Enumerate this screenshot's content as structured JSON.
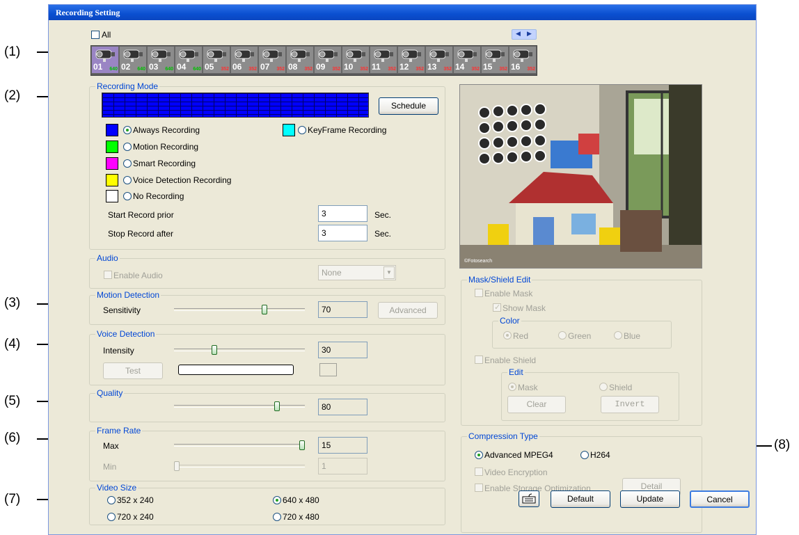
{
  "title": "Recording Setting",
  "callouts": [
    "(1)",
    "(2)",
    "(3)",
    "(4)",
    "(5)",
    "(6)",
    "(7)",
    "(8)"
  ],
  "camera_bar": {
    "all_label": "All",
    "cameras": [
      {
        "num": "01",
        "res": "640"
      },
      {
        "num": "02",
        "res": "640"
      },
      {
        "num": "03",
        "res": "640"
      },
      {
        "num": "04",
        "res": "640"
      },
      {
        "num": "05",
        "res": "352"
      },
      {
        "num": "06",
        "res": "352"
      },
      {
        "num": "07",
        "res": "352"
      },
      {
        "num": "08",
        "res": "352"
      },
      {
        "num": "09",
        "res": "352"
      },
      {
        "num": "10",
        "res": "352"
      },
      {
        "num": "11",
        "res": "352"
      },
      {
        "num": "12",
        "res": "352"
      },
      {
        "num": "13",
        "res": "352"
      },
      {
        "num": "14",
        "res": "352"
      },
      {
        "num": "15",
        "res": "352"
      },
      {
        "num": "16",
        "res": "352"
      }
    ],
    "selected": "01",
    "icons": [
      "camera-icon",
      "chevron-left-icon",
      "chevron-right-icon"
    ]
  },
  "recording_mode": {
    "label": "Recording Mode",
    "schedule_button": "Schedule",
    "options": [
      {
        "label": "Always Recording",
        "color": "#0000ff",
        "selected": true
      },
      {
        "label": "KeyFrame Recording",
        "color": "#00ffff",
        "selected": false
      },
      {
        "label": "Motion Recording",
        "color": "#00ff00",
        "selected": false
      },
      {
        "label": "Smart Recording",
        "color": "#ff00ff",
        "selected": false
      },
      {
        "label": "Voice Detection Recording",
        "color": "#ffff00",
        "selected": false
      },
      {
        "label": "No Recording",
        "color": "#ffffff",
        "selected": false
      }
    ],
    "start_prior_label": "Start Record prior",
    "start_prior_value": "3",
    "stop_after_label": "Stop Record after",
    "stop_after_value": "3",
    "sec_label": "Sec."
  },
  "audio": {
    "label": "Audio",
    "enable_label": "Enable Audio",
    "device_value": "None"
  },
  "motion_detection": {
    "label": "Motion Detection",
    "sensitivity_label": "Sensitivity",
    "sensitivity_value": "70",
    "advanced_button": "Advanced"
  },
  "voice_detection": {
    "label": "Voice Detection",
    "intensity_label": "Intensity",
    "intensity_value": "30",
    "test_button": "Test"
  },
  "quality": {
    "label": "Quality",
    "value": "80"
  },
  "frame_rate": {
    "label": "Frame Rate",
    "max_label": "Max",
    "max_value": "15",
    "min_label": "Min",
    "min_value": "1"
  },
  "video_size": {
    "label": "Video Size",
    "options": [
      {
        "label": "352 x 240",
        "selected": false
      },
      {
        "label": "640 x 480",
        "selected": true
      },
      {
        "label": "720 x 240",
        "selected": false
      },
      {
        "label": "720 x 480",
        "selected": false
      }
    ]
  },
  "mask_shield": {
    "label": "Mask/Shield Edit",
    "enable_mask": "Enable Mask",
    "show_mask": "Show Mask",
    "color_label": "Color",
    "colors": [
      "Red",
      "Green",
      "Blue"
    ],
    "enable_shield": "Enable Shield",
    "edit_label": "Edit",
    "edit_options": [
      "Mask",
      "Shield"
    ],
    "clear_button": "Clear",
    "invert_button": "Invert"
  },
  "compression": {
    "label": "Compression Type",
    "options": [
      {
        "label": "Advanced MPEG4",
        "selected": true
      },
      {
        "label": "H264",
        "selected": false
      }
    ],
    "video_encryption": "Video Encryption",
    "storage_optimization": "Enable Storage Optimization",
    "detail_button": "Detail"
  },
  "preview": {
    "watermark": "©Fotosearch"
  },
  "footer": {
    "default_button": "Default",
    "update_button": "Update",
    "cancel_button": "Cancel",
    "keyboard_icon": "keyboard-icon"
  },
  "slider_levels": {
    "sensitivity": 0.7,
    "intensity": 0.3,
    "quality": 0.8,
    "max_fps": 1.0,
    "min_fps": 0.0,
    "voice_meter": 0.0
  }
}
